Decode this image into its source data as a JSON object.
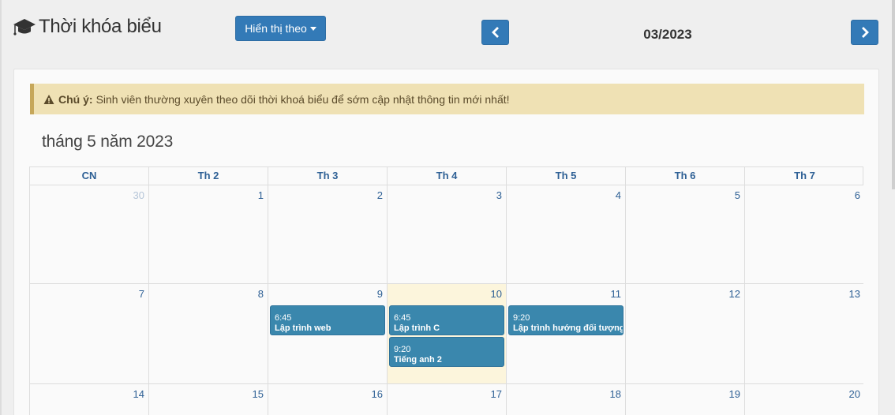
{
  "header": {
    "title": "Thời khóa biểu",
    "view_button_label": "Hiển thị theo",
    "current_period": "03/2023"
  },
  "alert": {
    "label": "Chú ý:",
    "message": "Sinh viên thường xuyên theo dõi thời khoá biểu để sớm cập nhật thông tin mới nhất!"
  },
  "calendar": {
    "title": "tháng 5 năm 2023",
    "weekdays": [
      "CN",
      "Th 2",
      "Th 3",
      "Th 4",
      "Th 5",
      "Th 6",
      "Th 7"
    ],
    "weeks": [
      [
        "30",
        "1",
        "2",
        "3",
        "4",
        "5",
        "6"
      ],
      [
        "7",
        "8",
        "9",
        "10",
        "11",
        "12",
        "13"
      ],
      [
        "14",
        "15",
        "16",
        "17",
        "18",
        "19",
        "20"
      ]
    ],
    "events": {
      "e1": {
        "time": "6:45",
        "title": "Lập trình web"
      },
      "e2": {
        "time": "6:45",
        "title": "Lập trình C"
      },
      "e3": {
        "time": "9:20",
        "title": "Tiếng anh 2"
      },
      "e4": {
        "time": "9:20",
        "title": "Lập trình hướng đối tượng"
      }
    }
  },
  "colors": {
    "primary": "#337ab7",
    "event": "#3a87ad",
    "today_bg": "#fcf5dc",
    "alert_bg": "#efe1b4"
  }
}
